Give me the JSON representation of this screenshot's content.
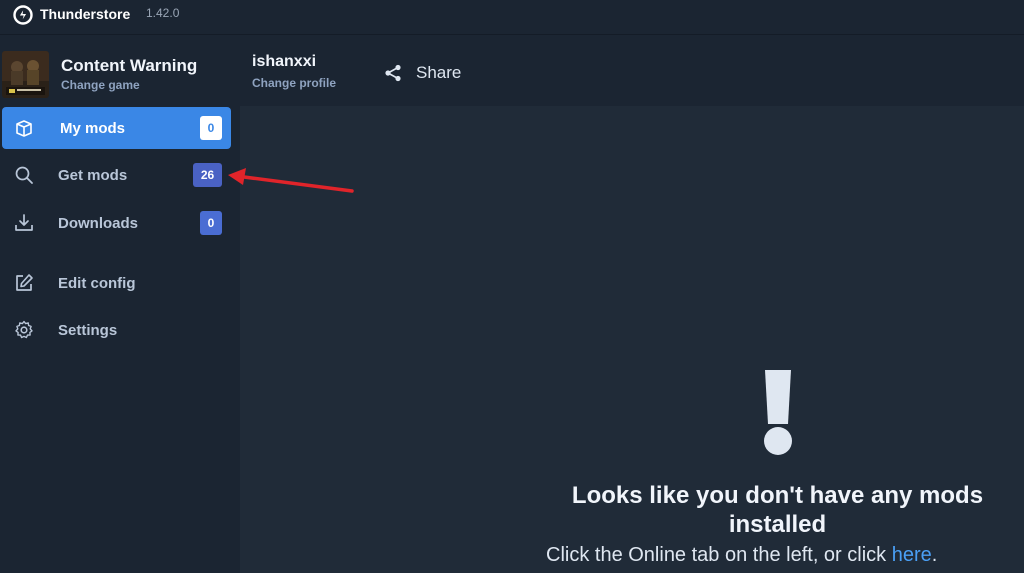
{
  "titlebar": {
    "app_name": "Thunderstore",
    "version": "1.42.0"
  },
  "game": {
    "name": "Content Warning",
    "change_label": "Change game"
  },
  "profile": {
    "name": "ishanxxi",
    "change_label": "Change profile"
  },
  "header": {
    "share_label": "Share"
  },
  "sidebar": {
    "items": [
      {
        "label": "My mods",
        "badge": "0",
        "icon": "box-icon",
        "active": true
      },
      {
        "label": "Get mods",
        "badge": "26",
        "icon": "search-icon"
      },
      {
        "label": "Downloads",
        "badge": "0",
        "icon": "download-icon"
      },
      {
        "label": "Edit config",
        "icon": "edit-icon"
      },
      {
        "label": "Settings",
        "icon": "gear-icon"
      }
    ]
  },
  "empty_state": {
    "icon": "exclamation-icon",
    "title": "Looks like you don't have any mods installed",
    "subtitle_prefix": "Click the Online tab on the left, or click ",
    "subtitle_link": "here",
    "subtitle_suffix": "."
  },
  "annotation": {
    "arrow_color": "#e0242a"
  },
  "colors": {
    "accent": "#3a87e6",
    "badge": "#4a6dd3",
    "background": "#1b2532",
    "panel": "#202b38"
  }
}
